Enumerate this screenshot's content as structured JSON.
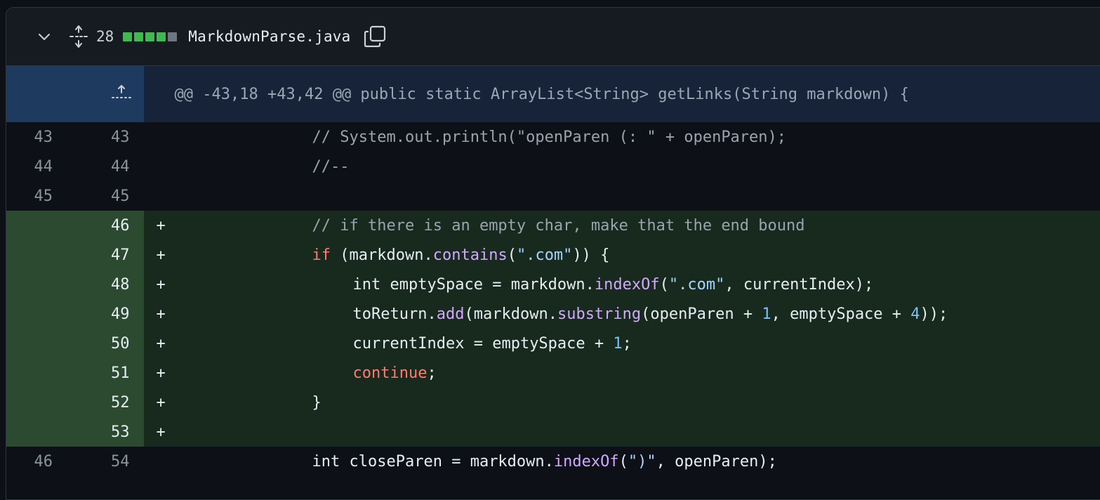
{
  "file": {
    "diffstat_count": "28",
    "diffstat_blocks": [
      "#3fb950",
      "#3fb950",
      "#3fb950",
      "#3fb950",
      "#6e7681"
    ],
    "name": "MarkdownParse.java",
    "icons": {
      "collapse": "chevron-down-icon",
      "expand": "expand-all-icon",
      "copy": "copy-icon",
      "hunk_expand": "expand-up-icon"
    }
  },
  "hunk": {
    "header": "@@ -43,18 +43,42 @@ public static ArrayList<String> getLinks(String markdown) {"
  },
  "lines": [
    {
      "type": "ctx",
      "old": "43",
      "new": "43",
      "marker": "",
      "indent": 2,
      "tokens": [
        {
          "t": "com",
          "v": "// System.out.println(\"openParen (: \" + openParen);"
        }
      ]
    },
    {
      "type": "ctx",
      "old": "44",
      "new": "44",
      "marker": "",
      "indent": 2,
      "tokens": [
        {
          "t": "com",
          "v": "//--"
        }
      ]
    },
    {
      "type": "ctx",
      "old": "45",
      "new": "45",
      "marker": "",
      "indent": 2,
      "tokens": []
    },
    {
      "type": "add",
      "old": "",
      "new": "46",
      "marker": "+",
      "indent": 2,
      "tokens": [
        {
          "t": "com",
          "v": "// if there is an empty char, make that the end bound"
        }
      ]
    },
    {
      "type": "add",
      "old": "",
      "new": "47",
      "marker": "+",
      "indent": 2,
      "tokens": [
        {
          "t": "kw",
          "v": "if"
        },
        {
          "t": "txt",
          "v": " (markdown."
        },
        {
          "t": "fn",
          "v": "contains"
        },
        {
          "t": "txt",
          "v": "("
        },
        {
          "t": "str",
          "v": "\".com\""
        },
        {
          "t": "txt",
          "v": ")) {"
        }
      ]
    },
    {
      "type": "add",
      "old": "",
      "new": "48",
      "marker": "+",
      "indent": 3,
      "tokens": [
        {
          "t": "txt",
          "v": "int emptySpace = markdown."
        },
        {
          "t": "fn",
          "v": "indexOf"
        },
        {
          "t": "txt",
          "v": "("
        },
        {
          "t": "str",
          "v": "\".com\""
        },
        {
          "t": "txt",
          "v": ", currentIndex);"
        }
      ]
    },
    {
      "type": "add",
      "old": "",
      "new": "49",
      "marker": "+",
      "indent": 3,
      "tokens": [
        {
          "t": "txt",
          "v": "toReturn."
        },
        {
          "t": "fn",
          "v": "add"
        },
        {
          "t": "txt",
          "v": "(markdown."
        },
        {
          "t": "fn",
          "v": "substring"
        },
        {
          "t": "txt",
          "v": "(openParen + "
        },
        {
          "t": "num",
          "v": "1"
        },
        {
          "t": "txt",
          "v": ", emptySpace + "
        },
        {
          "t": "num",
          "v": "4"
        },
        {
          "t": "txt",
          "v": "));"
        }
      ]
    },
    {
      "type": "add",
      "old": "",
      "new": "50",
      "marker": "+",
      "indent": 3,
      "tokens": [
        {
          "t": "txt",
          "v": "currentIndex = emptySpace + "
        },
        {
          "t": "num",
          "v": "1"
        },
        {
          "t": "txt",
          "v": ";"
        }
      ]
    },
    {
      "type": "add",
      "old": "",
      "new": "51",
      "marker": "+",
      "indent": 3,
      "tokens": [
        {
          "t": "kw",
          "v": "continue"
        },
        {
          "t": "txt",
          "v": ";"
        }
      ]
    },
    {
      "type": "add",
      "old": "",
      "new": "52",
      "marker": "+",
      "indent": 2,
      "tokens": [
        {
          "t": "txt",
          "v": "}"
        }
      ]
    },
    {
      "type": "add",
      "old": "",
      "new": "53",
      "marker": "+",
      "indent": 2,
      "tokens": []
    },
    {
      "type": "ctx",
      "old": "46",
      "new": "54",
      "marker": "",
      "indent": 2,
      "tokens": [
        {
          "t": "txt",
          "v": "int closeParen = markdown."
        },
        {
          "t": "fn",
          "v": "indexOf"
        },
        {
          "t": "txt",
          "v": "("
        },
        {
          "t": "str",
          "v": "\")\""
        },
        {
          "t": "txt",
          "v": ", openParen);"
        }
      ]
    }
  ]
}
